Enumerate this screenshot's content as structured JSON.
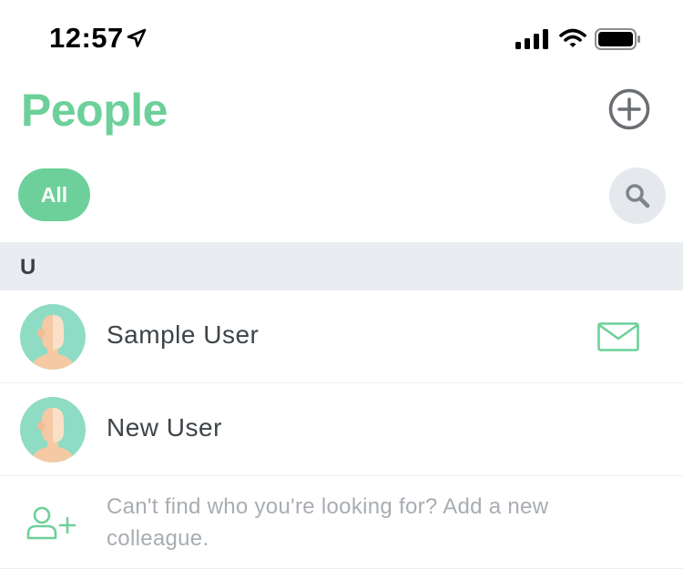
{
  "status_bar": {
    "time": "12:57",
    "icons": [
      "location-arrow-icon",
      "cellular-signal-icon",
      "wifi-icon",
      "battery-icon"
    ]
  },
  "header": {
    "title": "People",
    "add_icon": "plus-circle-icon"
  },
  "filters": {
    "active_label": "All",
    "search_icon": "search-icon"
  },
  "section": {
    "letter": "U"
  },
  "people": [
    {
      "name": "Sample User",
      "action_icon": "mail-icon"
    },
    {
      "name": "New User"
    }
  ],
  "footer_hint": {
    "text": "Can't find who you're looking for? Add a new colleague.",
    "icon": "add-user-icon"
  },
  "colors": {
    "accent": "#6dd09a",
    "section_bg": "#e9edf1",
    "search_bg": "#e5e9ee",
    "avatar_bg": "#8fdcc4",
    "text_dark": "#3f4448",
    "text_muted": "#a8adb2"
  }
}
